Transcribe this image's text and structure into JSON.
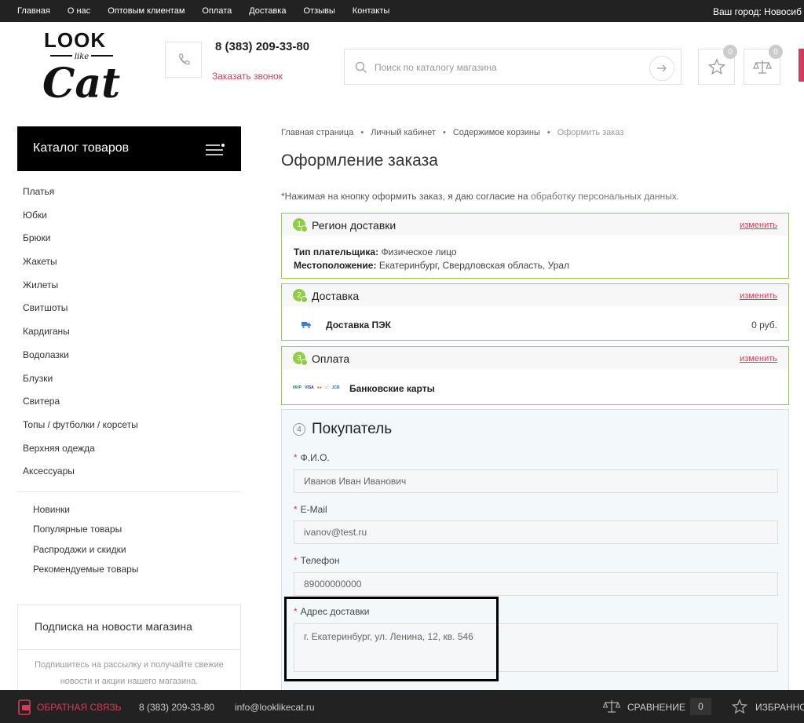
{
  "topbar": {
    "nav": [
      "Главная",
      "О нас",
      "Оптовым клиентам",
      "Оплата",
      "Доставка",
      "Отзывы",
      "Контакты"
    ],
    "city": "Ваш город: Новосиб"
  },
  "header": {
    "logo": {
      "line1": "LOOK",
      "line2": "like",
      "line3": "Cat"
    },
    "phone": "8 (383) 209-33-80",
    "callback": "Заказать звонок",
    "search_placeholder": "Поиск по каталогу магазина",
    "favorites_count": "0",
    "compare_count": "0",
    "accent_color": "#d53b5a"
  },
  "sidebar": {
    "catalog_title": "Каталог товаров",
    "categories": [
      "Платья",
      "Юбки",
      "Брюки",
      "Жакеты",
      "Жилеты",
      "Свитшоты",
      "Кардиганы",
      "Водолазки",
      "Блузки",
      "Свитера",
      "Топы / футболки / корсеты",
      "Верхняя одежда",
      "Аксессуары"
    ],
    "extra": [
      "Новинки",
      "Популярные товары",
      "Распродажи и скидки",
      "Рекомендуемые товары"
    ],
    "subscribe": {
      "title": "Подписка на новости магазина",
      "desc": "Подпишитесь на рассылку и получайте свежие новости и акции нашего магазина."
    }
  },
  "main": {
    "breadcrumbs": [
      "Главная страница",
      "Личный кабинет",
      "Содержимое корзины",
      "Оформить заказ"
    ],
    "title": "Оформление заказа",
    "consent_text": "*Нажимая на кнопку оформить заказ, я даю согласие на ",
    "consent_link": "обработку персональных данных.",
    "change_label": "изменить",
    "region": {
      "number": "1",
      "title": "Регион доставки",
      "payer_label": "Тип плательщика:",
      "payer_value": "Физическое лицо",
      "location_label": "Местоположение:",
      "location_value": "Екатеринбург, Свердловская область, Урал"
    },
    "delivery": {
      "number": "2",
      "title": "Доставка",
      "service": "Доставка ПЭК",
      "price": "0 руб."
    },
    "payment": {
      "number": "3",
      "title": "Оплата",
      "method": "Банковские карты",
      "card_icons": [
        "МИР",
        "VISA",
        "●●",
        "▭",
        "JCB"
      ]
    },
    "buyer": {
      "number": "4",
      "title": "Покупатель",
      "fields": [
        {
          "label": "Ф.И.О.",
          "value": "Иванов Иван Иванович"
        },
        {
          "label": "E-Mail",
          "value": "ivanov@test.ru"
        },
        {
          "label": "Телефон",
          "value": "89000000000"
        },
        {
          "label": "Адрес доставки",
          "value": "г. Екатеринбург, ул. Ленина, 12, кв. 546"
        }
      ]
    }
  },
  "bottombar": {
    "feedback": "ОБРАТНАЯ СВЯЗЬ",
    "phone": "8 (383) 209-33-80",
    "email": "info@looklikecat.ru",
    "compare": "СРАВНЕНИЕ",
    "compare_count": "0",
    "favorites": "ИЗБРАННОЕ"
  }
}
